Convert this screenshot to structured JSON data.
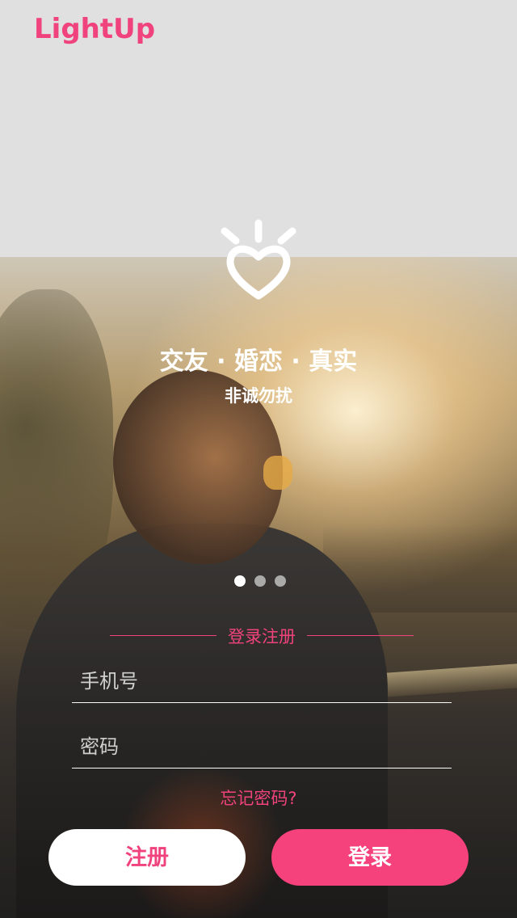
{
  "app": {
    "logo_text": "LightUp",
    "brand_color": "#f0437e"
  },
  "hero": {
    "icon": "heart-light-icon",
    "tagline": "交友 · 婚恋 · 真实",
    "subtagline": "非诚勿扰"
  },
  "carousel": {
    "page_count": 3,
    "active_index": 0
  },
  "login_form": {
    "section_title": "登录注册",
    "phone_placeholder": "手机号",
    "phone_value": "",
    "password_placeholder": "密码",
    "password_value": "",
    "forgot_password": "忘记密码?"
  },
  "actions": {
    "register_label": "注册",
    "login_label": "登录",
    "register_bg": "#ffffff",
    "login_bg": "#f5417c"
  }
}
